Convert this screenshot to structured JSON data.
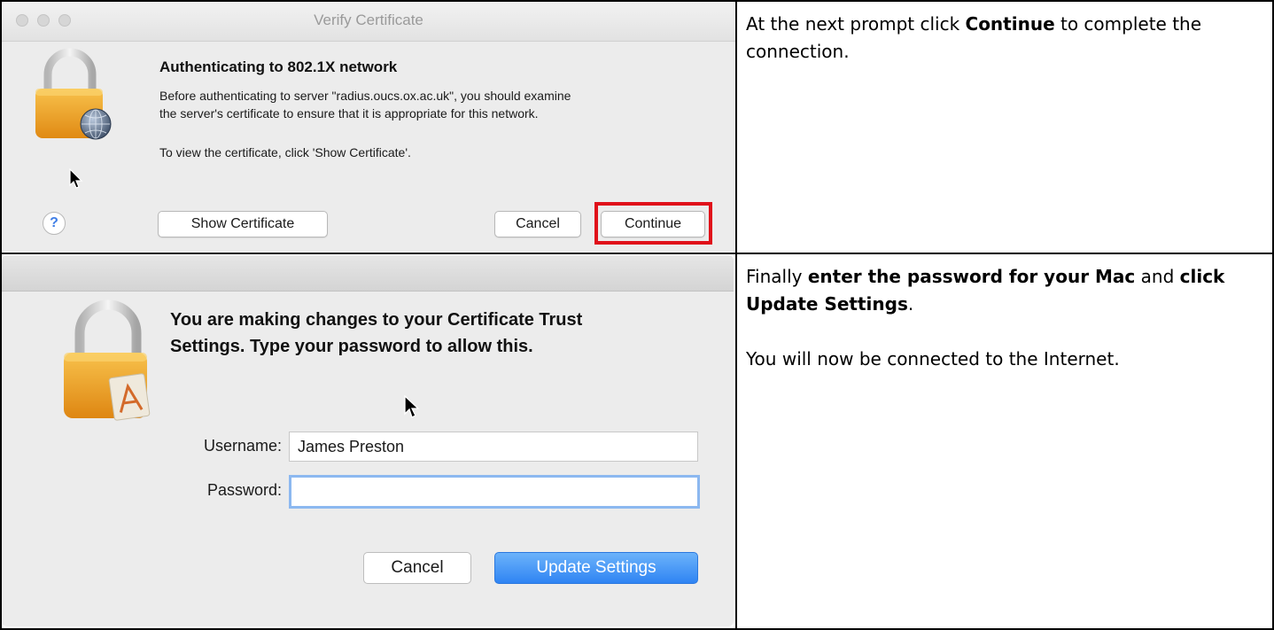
{
  "dialog1": {
    "title": "Verify Certificate",
    "heading": "Authenticating to 802.1X network",
    "body_line1": "Before authenticating to server \"radius.oucs.ox.ac.uk\", you should examine",
    "body_line2": "the server's certificate to ensure that it is appropriate for this network.",
    "body_line3": "To view the certificate, click 'Show Certificate'.",
    "help_label": "?",
    "show_certificate_label": "Show Certificate",
    "cancel_label": "Cancel",
    "continue_label": "Continue",
    "highlight_color": "#e0101a"
  },
  "instruction1": {
    "pre": "At the next prompt click ",
    "bold": "Continue",
    "post": " to complete the connection."
  },
  "dialog2": {
    "heading_line1": "You are making changes to your Certificate Trust",
    "heading_line2": "Settings. Type your password to allow this.",
    "username_label": "Username:",
    "username_value": "James Preston",
    "password_label": "Password:",
    "password_value": "",
    "cancel_label": "Cancel",
    "update_label": "Update Settings",
    "primary_color": "#2f84f3"
  },
  "instruction2": {
    "p1_pre": "Finally ",
    "p1_bold1": "enter the password for your Mac",
    "p1_mid": " and ",
    "p1_bold2": "click Update Settings",
    "p1_post": ".",
    "p2": "You will now be connected to the Internet."
  }
}
